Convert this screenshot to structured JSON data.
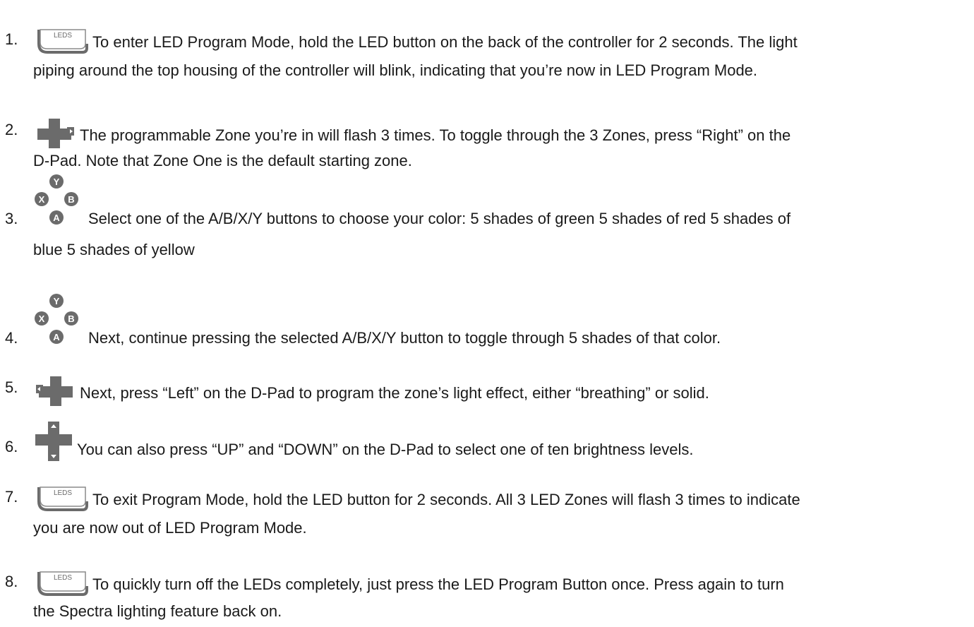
{
  "colors": {
    "text": "#1a1a1a",
    "icon": "#6b6b6b",
    "icon_fill": "#8a8a8a"
  },
  "steps": [
    {
      "number": "1.",
      "icon": "leds-button-icon",
      "icon_label": "LEDS",
      "line1": "To enter LED Program Mode, hold the LED button on the back of the controller for 2 seconds. The light",
      "line2": "piping around the top housing of the controller will blink,  indicating that you’re now in LED Program Mode."
    },
    {
      "number": "2.",
      "icon": "dpad-right-icon",
      "line1": "The programmable Zone you’re in will flash 3 times. To toggle through the 3 Zones, press “Right” on the",
      "line2": "D-Pad. Note that Zone One is the default starting zone."
    },
    {
      "number": "3.",
      "icon": "abxy-buttons-icon",
      "icon_letters": [
        "Y",
        "X",
        "B",
        "A"
      ],
      "line1": "Select one of the A/B/X/Y buttons to choose your color: 5 shades of green 5 shades of red 5 shades of",
      "line2": "blue 5 shades of yellow"
    },
    {
      "number": "4.",
      "icon": "abxy-buttons-icon",
      "icon_letters": [
        "Y",
        "X",
        "B",
        "A"
      ],
      "line1": "Next, continue pressing the selected A/B/X/Y button to toggle through 5 shades of that color."
    },
    {
      "number": "5.",
      "icon": "dpad-left-icon",
      "line1": "Next, press “Left” on the D-Pad to program the zone’s light effect, either “breathing” or solid."
    },
    {
      "number": "6.",
      "icon": "dpad-up-down-icon",
      "line1": "You can also press “UP” and “DOWN” on the D-Pad to select one of ten brightness levels."
    },
    {
      "number": "7.",
      "icon": "leds-button-icon",
      "icon_label": "LEDS",
      "line1": "To exit Program Mode, hold the LED button for 2 seconds. All 3 LED Zones will flash 3 times to indicate",
      "line2": "you are now out of LED Program Mode."
    },
    {
      "number": "8.",
      "icon": "leds-button-icon",
      "icon_label": "LEDS",
      "line1": "To quickly turn off the LEDs completely, just press the LED Program Button once. Press again to turn",
      "line2": "the Spectra lighting feature back on."
    }
  ]
}
